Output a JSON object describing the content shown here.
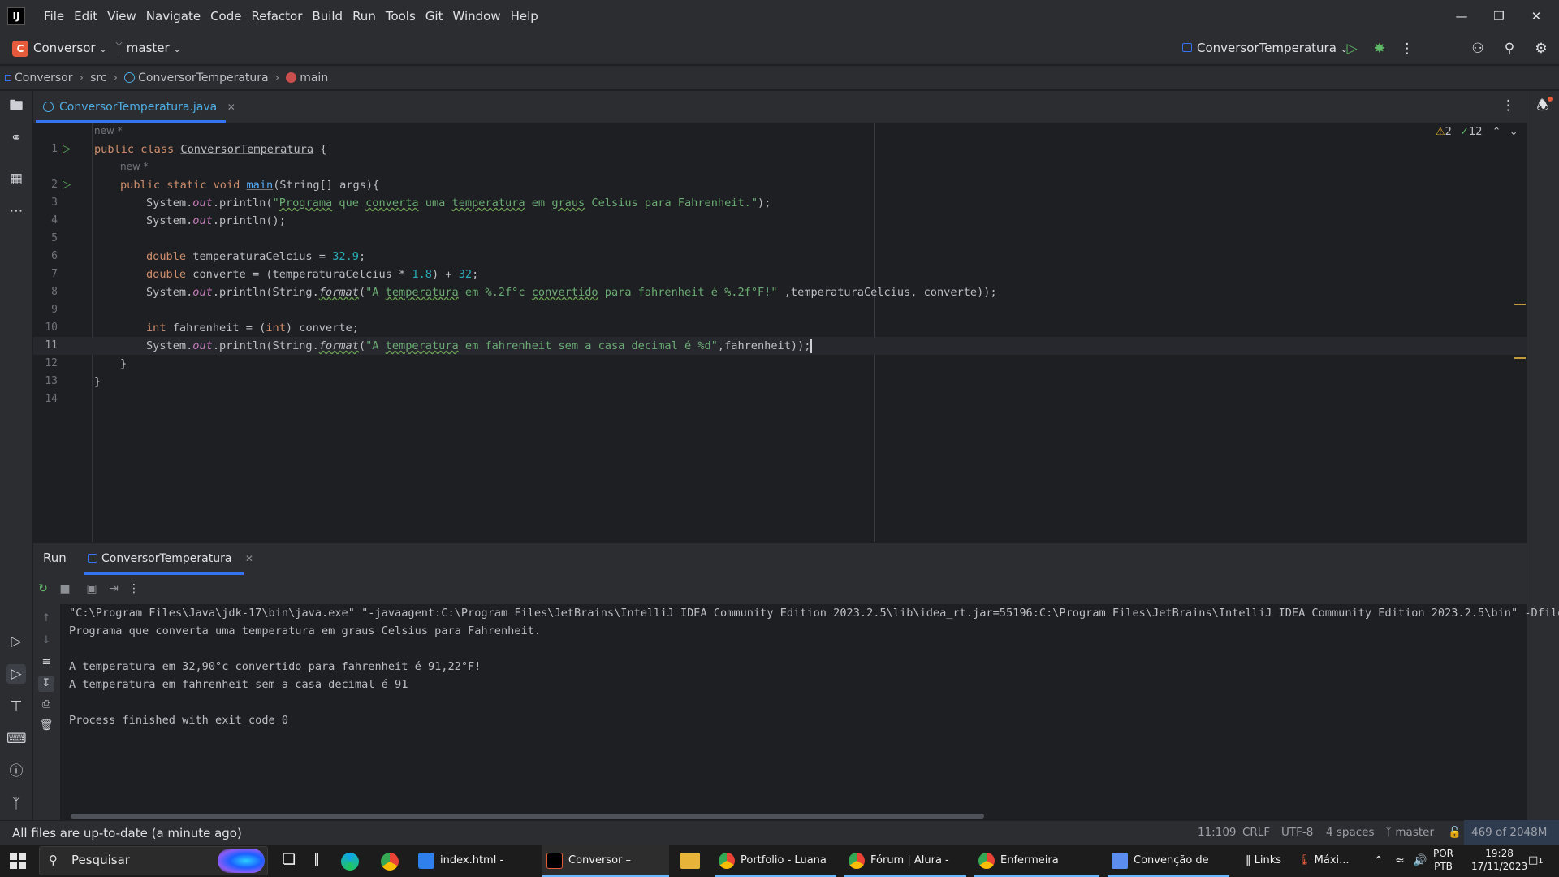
{
  "menu": [
    "File",
    "Edit",
    "View",
    "Navigate",
    "Code",
    "Refactor",
    "Build",
    "Run",
    "Tools",
    "Git",
    "Window",
    "Help"
  ],
  "toolbar": {
    "project_initial": "C",
    "project_name": "Conversor",
    "branch": "master",
    "run_config": "ConversorTemperatura"
  },
  "breadcrumb": [
    "Conversor",
    "src",
    "ConversorTemperatura",
    "main"
  ],
  "editor": {
    "tab_label": "ConversorTemperatura.java",
    "inspections_warnings": "2",
    "inspections_ok": "12",
    "hint": "new *",
    "line_numbers": [
      "1",
      "2",
      "3",
      "4",
      "5",
      "6",
      "7",
      "8",
      "9",
      "10",
      "11",
      "12",
      "13",
      "14"
    ]
  },
  "run_panel": {
    "title": "Run",
    "tab_label": "ConversorTemperatura",
    "console": [
      "\"C:\\Program Files\\Java\\jdk-17\\bin\\java.exe\" \"-javaagent:C:\\Program Files\\JetBrains\\IntelliJ IDEA Community Edition 2023.2.5\\lib\\idea_rt.jar=55196:C:\\Program Files\\JetBrains\\IntelliJ IDEA Community Edition 2023.2.5\\bin\" -Dfile",
      "Programa que converta uma temperatura em graus Celsius para Fahrenheit.",
      "",
      "A temperatura em 32,90°c convertido para fahrenheit é 91,22°F!",
      "A temperatura em fahrenheit sem a casa decimal é 91",
      "",
      "Process finished with exit code 0"
    ]
  },
  "status": {
    "message": "All files are up-to-date (a minute ago)",
    "position": "11:109",
    "line_sep": "CRLF",
    "encoding": "UTF-8",
    "indent": "4 spaces",
    "branch": "master",
    "memory": "469 of 2048M"
  },
  "taskbar": {
    "search_placeholder": "Pesquisar",
    "tasks": [
      "index.html - Portfo...",
      "Conversor – Conve...",
      "Portfolio - Luana –...",
      "Fórum | Alura - Cur...",
      "Enfermeira estética ...",
      "Convenção de códi..."
    ],
    "links": "Links",
    "weather": "Máxi...",
    "lang_top": "POR",
    "lang_bottom": "PTB",
    "time": "19:28",
    "date": "17/11/2023",
    "notif_count": "1"
  }
}
